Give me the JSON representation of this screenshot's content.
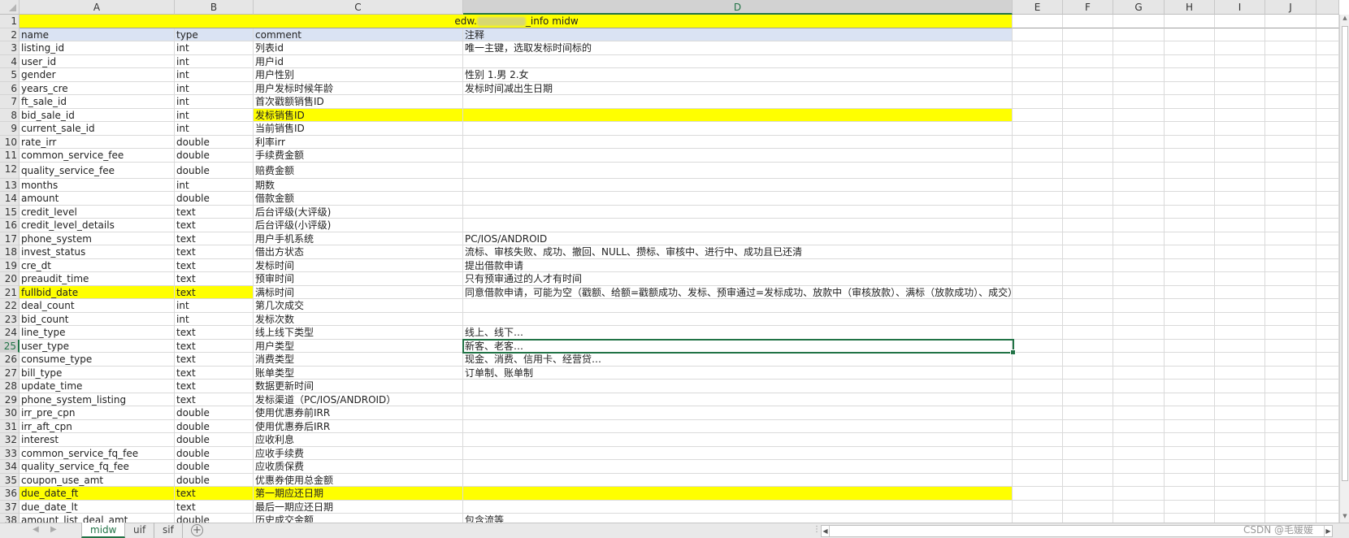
{
  "columns": [
    "A",
    "B",
    "C",
    "D",
    "E",
    "F",
    "G",
    "H",
    "I",
    "J"
  ],
  "selected_column": "D",
  "selected_row": "25",
  "title_row": {
    "prefix": "edw.",
    "suffix": "_info midw"
  },
  "header_row": {
    "name": "name",
    "type": "type",
    "comment": "comment",
    "note": "注释"
  },
  "rows": [
    {
      "n": "3",
      "name": "listing_id",
      "type": "int",
      "comment": "列表id",
      "note": "唯一主键，选取发标时间标的"
    },
    {
      "n": "4",
      "name": "user_id",
      "type": "int",
      "comment": "用户id",
      "note": ""
    },
    {
      "n": "5",
      "name": "gender",
      "type": "int",
      "comment": "用户性别",
      "note": "性别 1.男 2.女"
    },
    {
      "n": "6",
      "name": "years_cre",
      "type": "int",
      "comment": "用户发标时候年龄",
      "note": "发标时间减出生日期"
    },
    {
      "n": "7",
      "name": "ft_sale_id",
      "type": "int",
      "comment": "首次戳额销售ID",
      "note": ""
    },
    {
      "n": "8",
      "name": "bid_sale_id",
      "type": "int",
      "comment": "发标销售ID",
      "note": "",
      "hl_comment": true
    },
    {
      "n": "9",
      "name": "current_sale_id",
      "type": "int",
      "comment": "当前销售ID",
      "note": ""
    },
    {
      "n": "10",
      "name": "rate_irr",
      "type": "double",
      "comment": "利率irr",
      "note": ""
    },
    {
      "n": "11",
      "name": "common_service_fee",
      "type": "double",
      "comment": "手续费金额",
      "note": ""
    },
    {
      "n": "12",
      "name": "quality_service_fee",
      "type": "double",
      "comment": "赔费金额",
      "note": "",
      "tall": true
    },
    {
      "n": "13",
      "name": "months",
      "type": "int",
      "comment": "期数",
      "note": ""
    },
    {
      "n": "14",
      "name": "amount",
      "type": "double",
      "comment": "借款金额",
      "note": ""
    },
    {
      "n": "15",
      "name": "credit_level",
      "type": "text",
      "comment": "后台评级(大评级)",
      "note": ""
    },
    {
      "n": "16",
      "name": "credit_level_details",
      "type": "text",
      "comment": "后台评级(小评级)",
      "note": ""
    },
    {
      "n": "17",
      "name": "phone_system",
      "type": "text",
      "comment": "用户手机系统",
      "note": "PC/IOS/ANDROID"
    },
    {
      "n": "18",
      "name": "invest_status",
      "type": "text",
      "comment": "借出方状态",
      "note": "流标、审核失败、成功、撤回、NULL、攒标、审核中、进行中、成功且已还清"
    },
    {
      "n": "19",
      "name": "cre_dt",
      "type": "text",
      "comment": "发标时间",
      "note": "提出借款申请"
    },
    {
      "n": "20",
      "name": "preaudit_time",
      "type": "text",
      "comment": "预审时间",
      "note": "只有预审通过的人才有时间"
    },
    {
      "n": "21",
      "name": "fullbid_date",
      "type": "text",
      "comment": "满标时间",
      "note": "同意借款申请，可能为空（戳额、给额=戳额成功、发标、预审通过=发标成功、放款中（审核放款）、满标（放款成功）、成交）",
      "hl_name": true
    },
    {
      "n": "22",
      "name": "deal_count",
      "type": "int",
      "comment": "第几次成交",
      "note": ""
    },
    {
      "n": "23",
      "name": "bid_count",
      "type": "int",
      "comment": "发标次数",
      "note": ""
    },
    {
      "n": "24",
      "name": "line_type",
      "type": "text",
      "comment": "线上线下类型",
      "note": "线上、线下…"
    },
    {
      "n": "25",
      "name": "user_type",
      "type": "text",
      "comment": "用户类型",
      "note": "新客、老客…"
    },
    {
      "n": "26",
      "name": "consume_type",
      "type": "text",
      "comment": "消费类型",
      "note": "现金、消费、信用卡、经营贷…"
    },
    {
      "n": "27",
      "name": "bill_type",
      "type": "text",
      "comment": "账单类型",
      "note": "订单制、账单制"
    },
    {
      "n": "28",
      "name": "update_time",
      "type": "text",
      "comment": "数据更新时间",
      "note": ""
    },
    {
      "n": "29",
      "name": "phone_system_listing",
      "type": "text",
      "comment": "发标渠道（PC/IOS/ANDROID）",
      "note": ""
    },
    {
      "n": "30",
      "name": "irr_pre_cpn",
      "type": "double",
      "comment": "使用优惠券前IRR",
      "note": ""
    },
    {
      "n": "31",
      "name": "irr_aft_cpn",
      "type": "double",
      "comment": "使用优惠券后IRR",
      "note": ""
    },
    {
      "n": "32",
      "name": "interest",
      "type": "double",
      "comment": "应收利息",
      "note": ""
    },
    {
      "n": "33",
      "name": "common_service_fq_fee",
      "type": "double",
      "comment": "应收手续费",
      "note": ""
    },
    {
      "n": "34",
      "name": "quality_service_fq_fee",
      "type": "double",
      "comment": "应收质保费",
      "note": ""
    },
    {
      "n": "35",
      "name": "coupon_use_amt",
      "type": "double",
      "comment": "优惠券使用总金额",
      "note": ""
    },
    {
      "n": "36",
      "name": "due_date_ft",
      "type": "text",
      "comment": "第一期应还日期",
      "note": "",
      "hl_all": true
    },
    {
      "n": "37",
      "name": "due_date_lt",
      "type": "text",
      "comment": "最后一期应还日期",
      "note": ""
    },
    {
      "n": "38",
      "name": "amount_list_deal_amt",
      "type": "double",
      "comment": "历史成交金额",
      "note": "包含流等"
    }
  ],
  "sheet_tabs": [
    {
      "label": "midw",
      "active": true
    },
    {
      "label": "uif"
    },
    {
      "label": "sif"
    }
  ],
  "add_sheet": "+",
  "watermark": "CSDN @毛媛媛",
  "colors": {
    "highlight": "#ffff00",
    "header_fill": "#dae3f3",
    "accent": "#217346"
  }
}
